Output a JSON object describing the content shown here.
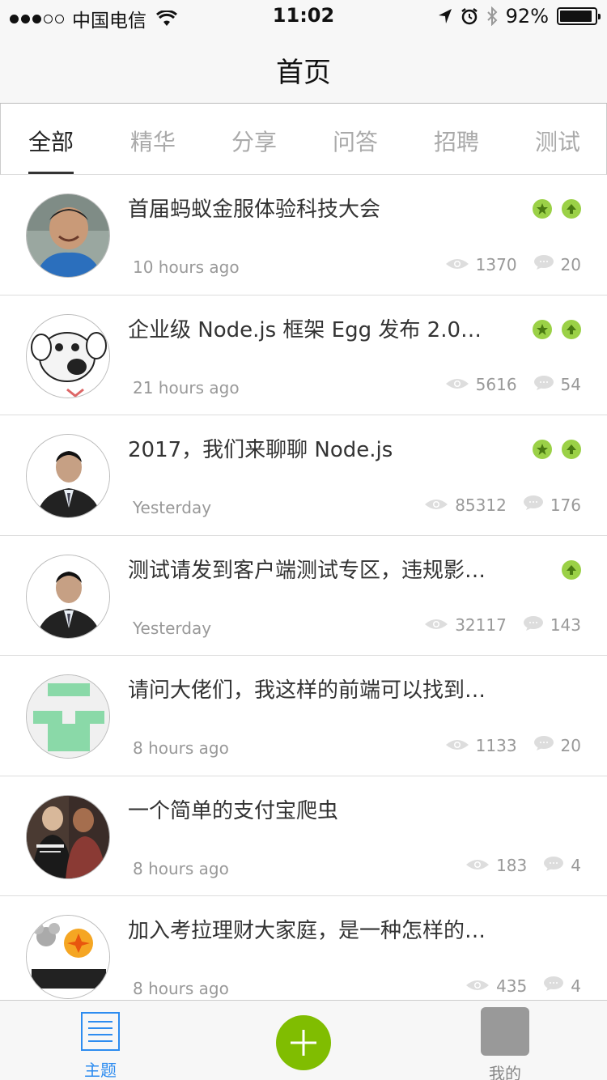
{
  "status_bar": {
    "carrier": "中国电信",
    "time": "11:02",
    "battery": "92%",
    "battery_level": 0.92
  },
  "nav": {
    "title": "首页"
  },
  "tabs": [
    {
      "label": "全部",
      "active": true
    },
    {
      "label": "精华",
      "active": false
    },
    {
      "label": "分享",
      "active": false
    },
    {
      "label": "问答",
      "active": false
    },
    {
      "label": "招聘",
      "active": false
    },
    {
      "label": "测试",
      "active": false
    }
  ],
  "topics": [
    {
      "title": "首届蚂蚁金服体验科技大会",
      "time": "10 hours ago",
      "views": "1370",
      "replies": "20",
      "good": true,
      "top": true,
      "avatar_icon": "man-laughing-avatar"
    },
    {
      "title": "企业级 Node.js 框架 Egg 发布 2.0…",
      "time": "21 hours ago",
      "views": "5616",
      "replies": "54",
      "good": true,
      "top": true,
      "avatar_icon": "cartoon-dog-avatar"
    },
    {
      "title": "2017，我们来聊聊 Node.js",
      "time": "Yesterday",
      "views": "85312",
      "replies": "176",
      "good": true,
      "top": true,
      "avatar_icon": "man-suit-avatar"
    },
    {
      "title": "测试请发到客户端测试专区，违规影…",
      "time": "Yesterday",
      "views": "32117",
      "replies": "143",
      "good": false,
      "top": true,
      "avatar_icon": "man-suit-avatar"
    },
    {
      "title": "请问大佬们，我这样的前端可以找到…",
      "time": "8 hours ago",
      "views": "1133",
      "replies": "20",
      "good": false,
      "top": false,
      "avatar_icon": "identicon-avatar"
    },
    {
      "title": "一个简单的支付宝爬虫",
      "time": "8 hours ago",
      "views": "183",
      "replies": "4",
      "good": false,
      "top": false,
      "avatar_icon": "band-photo-avatar"
    },
    {
      "title": "加入考拉理财大家庭，是一种怎样的…",
      "time": "8 hours ago",
      "views": "435",
      "replies": "4",
      "good": false,
      "top": false,
      "avatar_icon": "koala-logo-avatar"
    }
  ],
  "tab_bar": {
    "topics_label": "主题",
    "me_label": "我的"
  },
  "colors": {
    "badge_green": "#9bd147",
    "add_button": "#80bd01",
    "active_tab_bar": "#2d8cf0"
  }
}
